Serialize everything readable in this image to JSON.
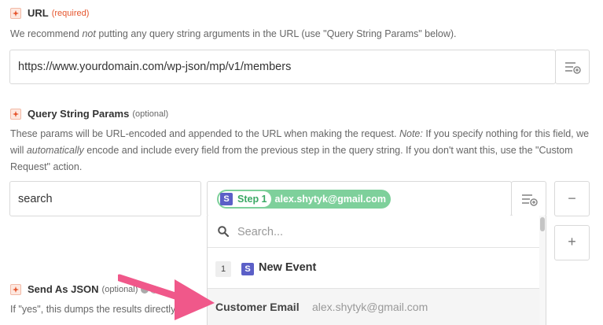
{
  "url_field": {
    "title": "URL",
    "required_label": "(required)",
    "help_before": "We recommend ",
    "help_em": "not",
    "help_after": " putting any query string arguments in the URL (use \"Query String Params\" below).",
    "value": "https://www.yourdomain.com/wp-json/mp/v1/members"
  },
  "query_params": {
    "title": "Query String Params",
    "optional_label": "(optional)",
    "help_1": "These params will be URL-encoded and appended to the URL when making the request. ",
    "help_note": "Note:",
    "help_2": " If you specify nothing for this field, we will ",
    "help_em": "automatically",
    "help_3": " encode and include every field from the previous step in the query string. If you don't want this, use the \"Custom Request\" action.",
    "key": "search",
    "pill": {
      "badge": "S",
      "step": "Step 1",
      "value": "alex.shytyk@gmail.com"
    },
    "remove_label": "−",
    "add_label": "+"
  },
  "dropdown": {
    "search_placeholder": "Search...",
    "step_number": "1",
    "step_badge": "S",
    "step_name": "New Event",
    "option_label": "Customer Email",
    "option_value": "alex.shytyk@gmail.com"
  },
  "send_json": {
    "title": "Send As JSON",
    "optional_label": "(optional)",
    "help": "If \"yes\", this dumps the results directly into"
  },
  "colors": {
    "arrow": "#f0588a",
    "pill": "#7ed09b",
    "badge": "#5b5fc7",
    "required": "#e5552d"
  }
}
